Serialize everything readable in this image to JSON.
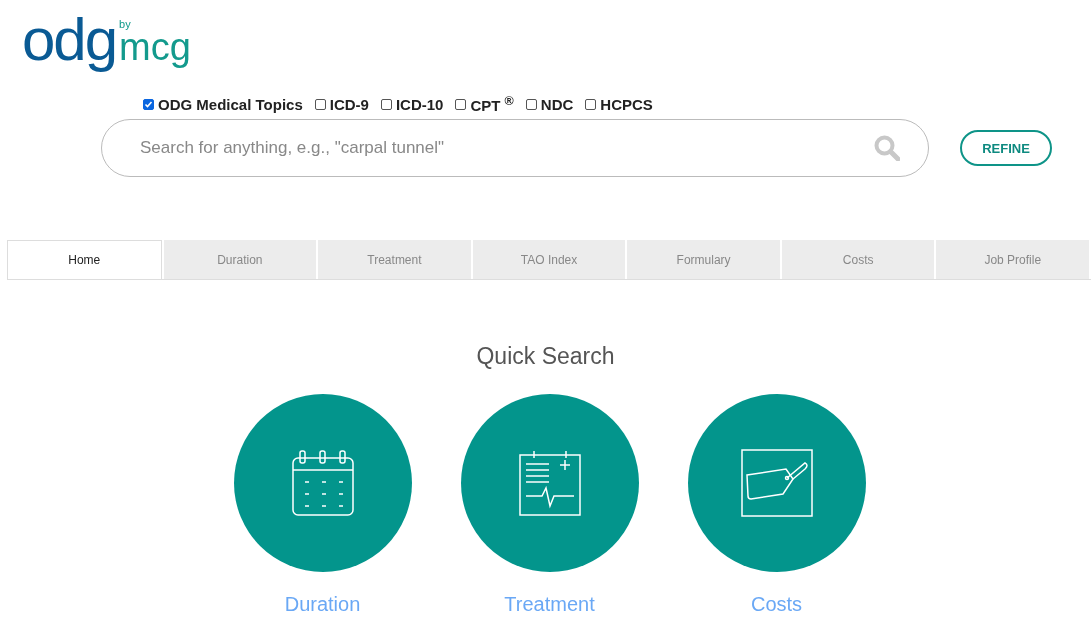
{
  "logo": {
    "main": "odg",
    "by": "by",
    "sub": "mcg"
  },
  "filters": [
    {
      "label": "ODG Medical Topics",
      "checked": true
    },
    {
      "label": "ICD-9",
      "checked": false
    },
    {
      "label": "ICD-10",
      "checked": false
    },
    {
      "label": "CPT $^{®}$",
      "checked": false
    },
    {
      "label": "NDC",
      "checked": false
    },
    {
      "label": "HCPCS",
      "checked": false
    }
  ],
  "search": {
    "placeholder": "Search for anything, e.g., \"carpal tunnel\""
  },
  "refine_button": "REFINE",
  "tabs": [
    {
      "label": "Home",
      "selected": true
    },
    {
      "label": "Duration",
      "selected": false
    },
    {
      "label": "Treatment",
      "selected": false
    },
    {
      "label": "TAO Index",
      "selected": false
    },
    {
      "label": "Formulary",
      "selected": false
    },
    {
      "label": "Costs",
      "selected": false
    },
    {
      "label": "Job Profile",
      "selected": false
    }
  ],
  "quick_search": {
    "title": "Quick Search",
    "items": [
      {
        "kind": "calendar",
        "label": "Duration"
      },
      {
        "kind": "chart",
        "label": "Treatment"
      },
      {
        "kind": "tag",
        "label": "Costs"
      }
    ]
  }
}
